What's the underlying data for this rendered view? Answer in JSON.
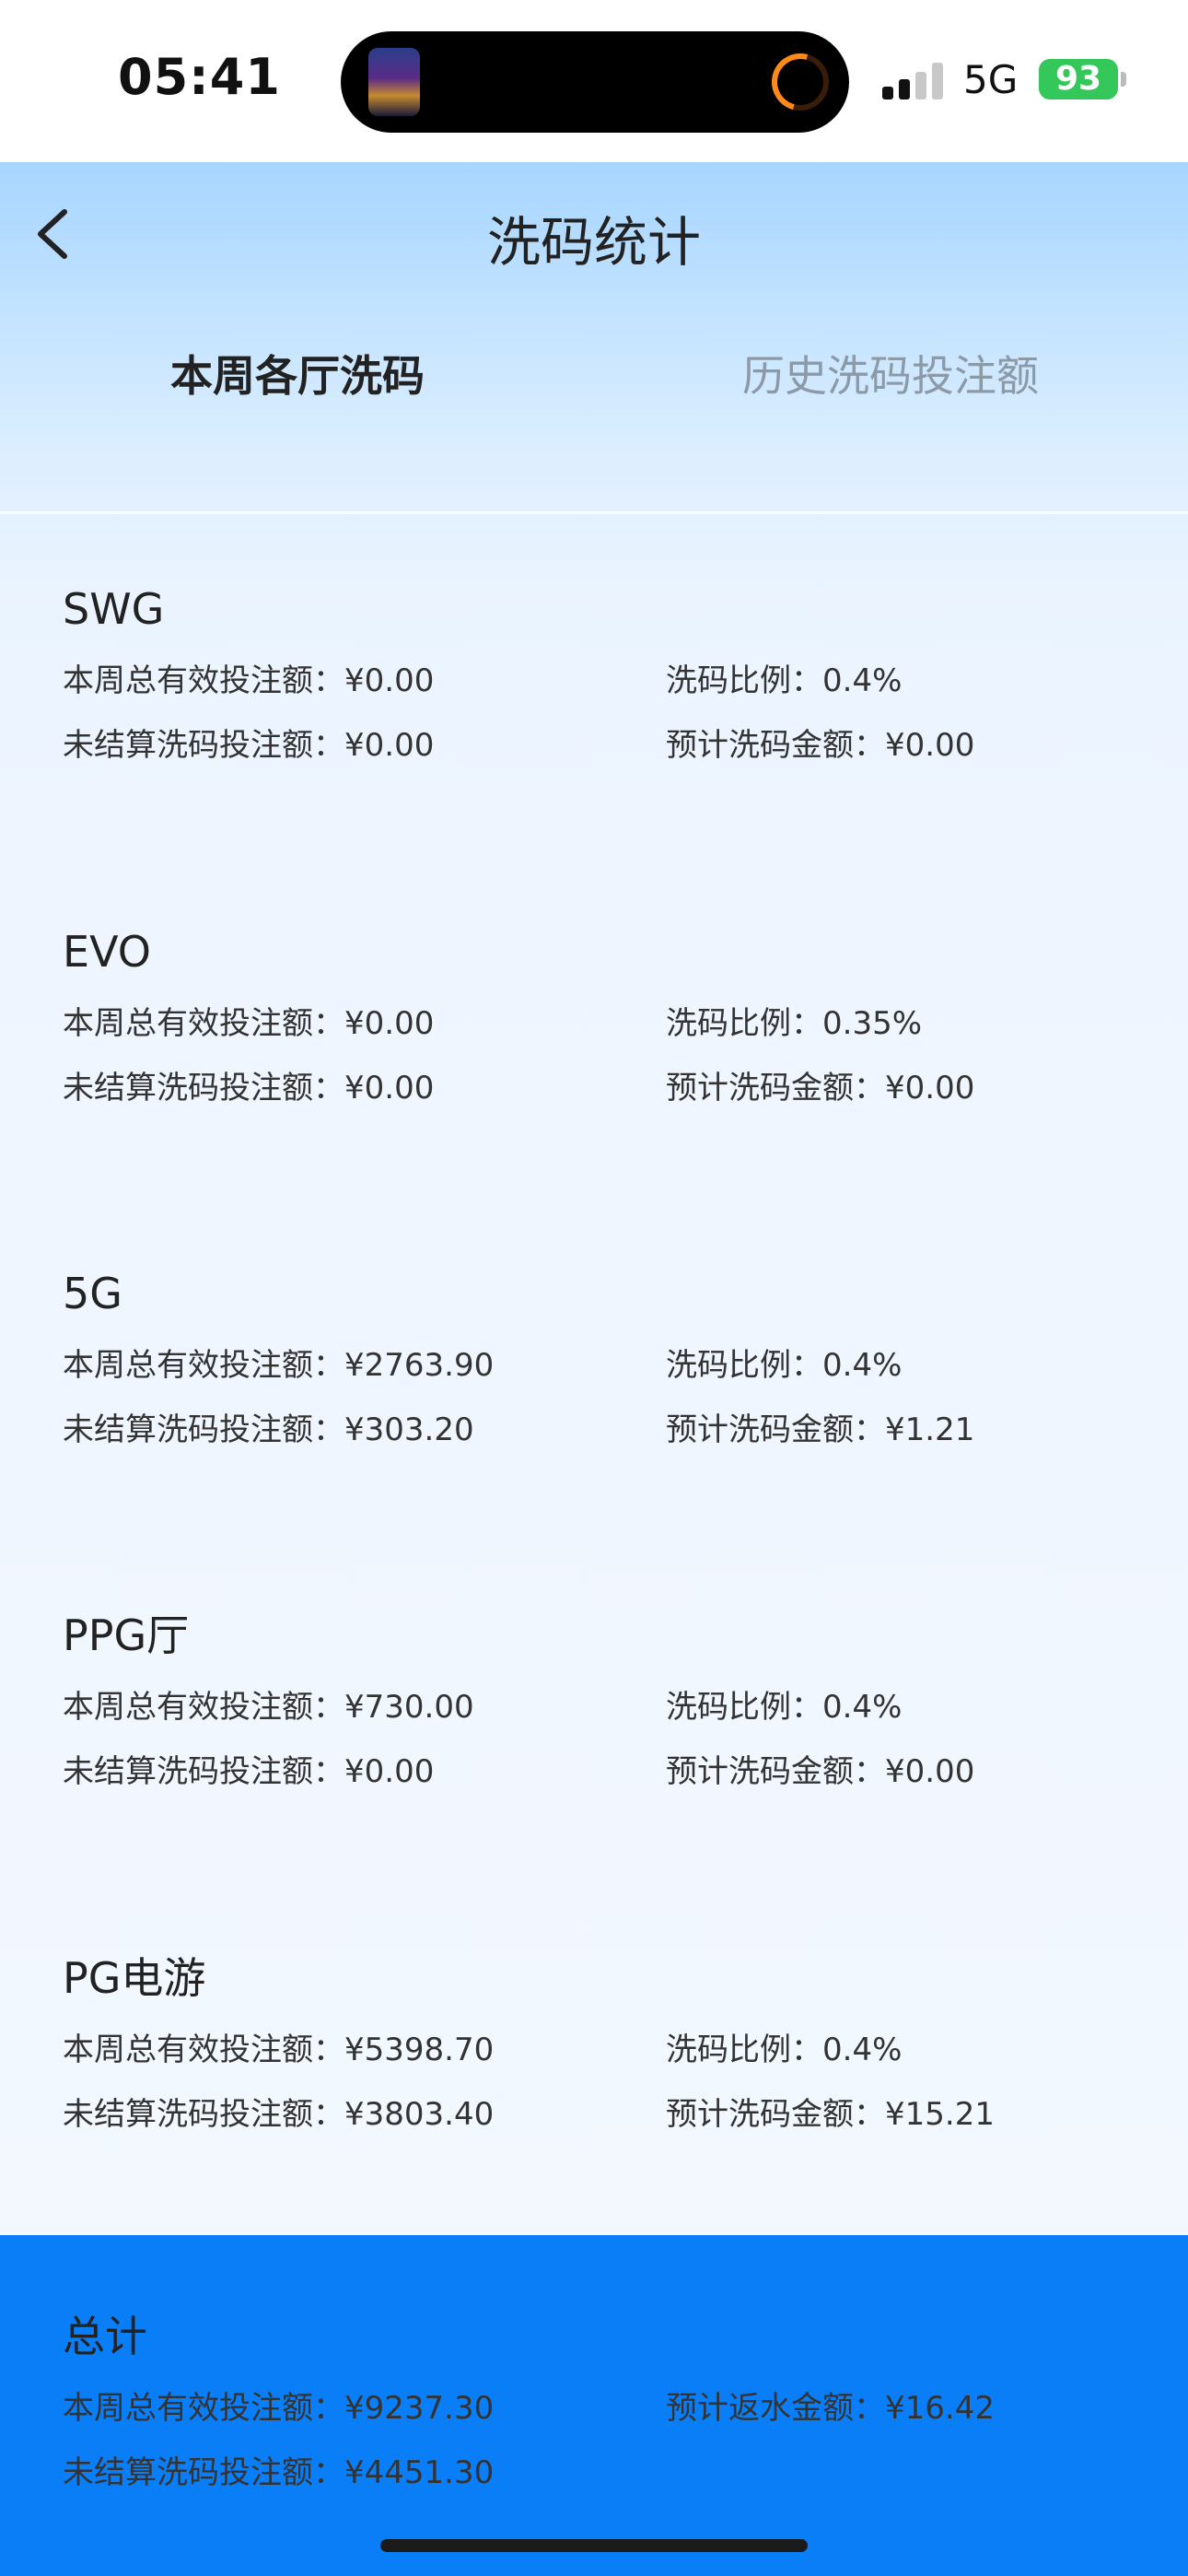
{
  "status_bar": {
    "time": "05:41",
    "network": "5G",
    "battery": "93"
  },
  "header": {
    "title": "洗码统计",
    "tabs": [
      {
        "label": "本周各厅洗码",
        "active": true
      },
      {
        "label": "历史洗码投注额",
        "active": false
      }
    ]
  },
  "halls": [
    {
      "name": "SWG",
      "weekly_valid_bet": "本周总有效投注额：¥0.00",
      "rate": "洗码比例：0.4%",
      "unsettled_bet": "未结算洗码投注额：¥0.00",
      "estimated_amount": "预计洗码金额：¥0.00"
    },
    {
      "name": "EVO",
      "weekly_valid_bet": "本周总有效投注额：¥0.00",
      "rate": "洗码比例：0.35%",
      "unsettled_bet": "未结算洗码投注额：¥0.00",
      "estimated_amount": "预计洗码金额：¥0.00"
    },
    {
      "name": "5G",
      "weekly_valid_bet": "本周总有效投注额：¥2763.90",
      "rate": "洗码比例：0.4%",
      "unsettled_bet": "未结算洗码投注额：¥303.20",
      "estimated_amount": "预计洗码金额：¥1.21"
    },
    {
      "name": "PPG厅",
      "weekly_valid_bet": "本周总有效投注额：¥730.00",
      "rate": "洗码比例：0.4%",
      "unsettled_bet": "未结算洗码投注额：¥0.00",
      "estimated_amount": "预计洗码金额：¥0.00"
    },
    {
      "name": "PG电游",
      "weekly_valid_bet": "本周总有效投注额：¥5398.70",
      "rate": "洗码比例：0.4%",
      "unsettled_bet": "未结算洗码投注额：¥3803.40",
      "estimated_amount": "预计洗码金额：¥15.21"
    }
  ],
  "total": {
    "title": "总计",
    "weekly_valid_bet": "本周总有效投注额：¥9237.30",
    "estimated_rebate": "预计返水金额：¥16.42",
    "unsettled_bet": "未结算洗码投注额：¥4451.30"
  },
  "colors": {
    "header_blue": "#a7d5ff",
    "total_bar": "#0a7ef7",
    "battery_green": "#34c759"
  }
}
